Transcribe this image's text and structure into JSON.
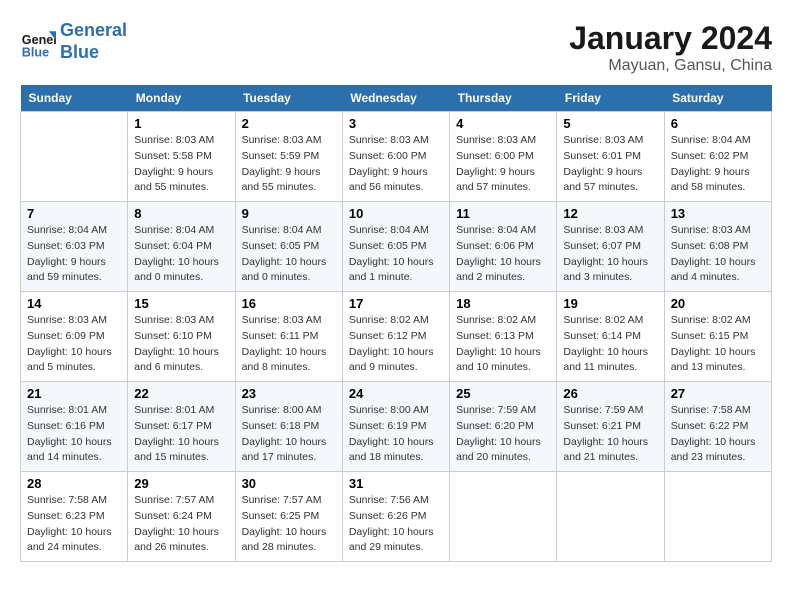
{
  "header": {
    "logo_line1": "General",
    "logo_line2": "Blue",
    "month": "January 2024",
    "location": "Mayuan, Gansu, China"
  },
  "weekdays": [
    "Sunday",
    "Monday",
    "Tuesday",
    "Wednesday",
    "Thursday",
    "Friday",
    "Saturday"
  ],
  "weeks": [
    [
      {
        "day": "",
        "empty": true
      },
      {
        "day": "1",
        "sunrise": "Sunrise: 8:03 AM",
        "sunset": "Sunset: 5:58 PM",
        "daylight": "Daylight: 9 hours and 55 minutes."
      },
      {
        "day": "2",
        "sunrise": "Sunrise: 8:03 AM",
        "sunset": "Sunset: 5:59 PM",
        "daylight": "Daylight: 9 hours and 55 minutes."
      },
      {
        "day": "3",
        "sunrise": "Sunrise: 8:03 AM",
        "sunset": "Sunset: 6:00 PM",
        "daylight": "Daylight: 9 hours and 56 minutes."
      },
      {
        "day": "4",
        "sunrise": "Sunrise: 8:03 AM",
        "sunset": "Sunset: 6:00 PM",
        "daylight": "Daylight: 9 hours and 57 minutes."
      },
      {
        "day": "5",
        "sunrise": "Sunrise: 8:03 AM",
        "sunset": "Sunset: 6:01 PM",
        "daylight": "Daylight: 9 hours and 57 minutes."
      },
      {
        "day": "6",
        "sunrise": "Sunrise: 8:04 AM",
        "sunset": "Sunset: 6:02 PM",
        "daylight": "Daylight: 9 hours and 58 minutes."
      }
    ],
    [
      {
        "day": "7",
        "sunrise": "Sunrise: 8:04 AM",
        "sunset": "Sunset: 6:03 PM",
        "daylight": "Daylight: 9 hours and 59 minutes."
      },
      {
        "day": "8",
        "sunrise": "Sunrise: 8:04 AM",
        "sunset": "Sunset: 6:04 PM",
        "daylight": "Daylight: 10 hours and 0 minutes."
      },
      {
        "day": "9",
        "sunrise": "Sunrise: 8:04 AM",
        "sunset": "Sunset: 6:05 PM",
        "daylight": "Daylight: 10 hours and 0 minutes."
      },
      {
        "day": "10",
        "sunrise": "Sunrise: 8:04 AM",
        "sunset": "Sunset: 6:05 PM",
        "daylight": "Daylight: 10 hours and 1 minute."
      },
      {
        "day": "11",
        "sunrise": "Sunrise: 8:04 AM",
        "sunset": "Sunset: 6:06 PM",
        "daylight": "Daylight: 10 hours and 2 minutes."
      },
      {
        "day": "12",
        "sunrise": "Sunrise: 8:03 AM",
        "sunset": "Sunset: 6:07 PM",
        "daylight": "Daylight: 10 hours and 3 minutes."
      },
      {
        "day": "13",
        "sunrise": "Sunrise: 8:03 AM",
        "sunset": "Sunset: 6:08 PM",
        "daylight": "Daylight: 10 hours and 4 minutes."
      }
    ],
    [
      {
        "day": "14",
        "sunrise": "Sunrise: 8:03 AM",
        "sunset": "Sunset: 6:09 PM",
        "daylight": "Daylight: 10 hours and 5 minutes."
      },
      {
        "day": "15",
        "sunrise": "Sunrise: 8:03 AM",
        "sunset": "Sunset: 6:10 PM",
        "daylight": "Daylight: 10 hours and 6 minutes."
      },
      {
        "day": "16",
        "sunrise": "Sunrise: 8:03 AM",
        "sunset": "Sunset: 6:11 PM",
        "daylight": "Daylight: 10 hours and 8 minutes."
      },
      {
        "day": "17",
        "sunrise": "Sunrise: 8:02 AM",
        "sunset": "Sunset: 6:12 PM",
        "daylight": "Daylight: 10 hours and 9 minutes."
      },
      {
        "day": "18",
        "sunrise": "Sunrise: 8:02 AM",
        "sunset": "Sunset: 6:13 PM",
        "daylight": "Daylight: 10 hours and 10 minutes."
      },
      {
        "day": "19",
        "sunrise": "Sunrise: 8:02 AM",
        "sunset": "Sunset: 6:14 PM",
        "daylight": "Daylight: 10 hours and 11 minutes."
      },
      {
        "day": "20",
        "sunrise": "Sunrise: 8:02 AM",
        "sunset": "Sunset: 6:15 PM",
        "daylight": "Daylight: 10 hours and 13 minutes."
      }
    ],
    [
      {
        "day": "21",
        "sunrise": "Sunrise: 8:01 AM",
        "sunset": "Sunset: 6:16 PM",
        "daylight": "Daylight: 10 hours and 14 minutes."
      },
      {
        "day": "22",
        "sunrise": "Sunrise: 8:01 AM",
        "sunset": "Sunset: 6:17 PM",
        "daylight": "Daylight: 10 hours and 15 minutes."
      },
      {
        "day": "23",
        "sunrise": "Sunrise: 8:00 AM",
        "sunset": "Sunset: 6:18 PM",
        "daylight": "Daylight: 10 hours and 17 minutes."
      },
      {
        "day": "24",
        "sunrise": "Sunrise: 8:00 AM",
        "sunset": "Sunset: 6:19 PM",
        "daylight": "Daylight: 10 hours and 18 minutes."
      },
      {
        "day": "25",
        "sunrise": "Sunrise: 7:59 AM",
        "sunset": "Sunset: 6:20 PM",
        "daylight": "Daylight: 10 hours and 20 minutes."
      },
      {
        "day": "26",
        "sunrise": "Sunrise: 7:59 AM",
        "sunset": "Sunset: 6:21 PM",
        "daylight": "Daylight: 10 hours and 21 minutes."
      },
      {
        "day": "27",
        "sunrise": "Sunrise: 7:58 AM",
        "sunset": "Sunset: 6:22 PM",
        "daylight": "Daylight: 10 hours and 23 minutes."
      }
    ],
    [
      {
        "day": "28",
        "sunrise": "Sunrise: 7:58 AM",
        "sunset": "Sunset: 6:23 PM",
        "daylight": "Daylight: 10 hours and 24 minutes."
      },
      {
        "day": "29",
        "sunrise": "Sunrise: 7:57 AM",
        "sunset": "Sunset: 6:24 PM",
        "daylight": "Daylight: 10 hours and 26 minutes."
      },
      {
        "day": "30",
        "sunrise": "Sunrise: 7:57 AM",
        "sunset": "Sunset: 6:25 PM",
        "daylight": "Daylight: 10 hours and 28 minutes."
      },
      {
        "day": "31",
        "sunrise": "Sunrise: 7:56 AM",
        "sunset": "Sunset: 6:26 PM",
        "daylight": "Daylight: 10 hours and 29 minutes."
      },
      {
        "day": "",
        "empty": true
      },
      {
        "day": "",
        "empty": true
      },
      {
        "day": "",
        "empty": true
      }
    ]
  ]
}
